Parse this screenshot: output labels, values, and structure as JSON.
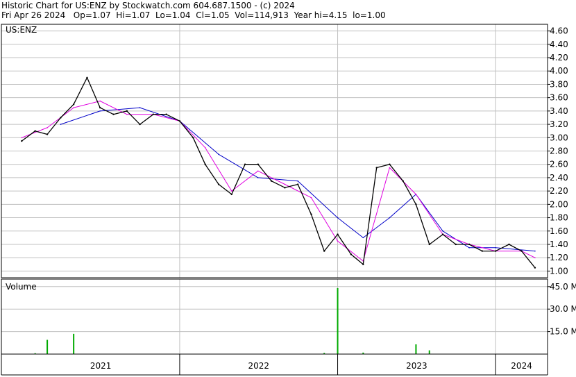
{
  "header": {
    "line1": "Historic Chart for US:ENZ by Stockwatch.com 604.687.1500 - (c) 2024",
    "line2": "Fri Apr 26 2024   Op=1.07  Hi=1.07  Lo=1.04  Cl=1.05  Vol=114,913  Year hi=4.15  lo=1.00"
  },
  "price_panel": {
    "label": "US:ENZ"
  },
  "volume_panel": {
    "label": "Volume"
  },
  "colors": {
    "price": "#000000",
    "ma_short": "#e000e0",
    "ma_long": "#0000c8",
    "grid": "#c0c0c0",
    "volume_up": "#00aa00",
    "volume_down": "#cc0000",
    "frame": "#000000"
  },
  "chart_data": [
    {
      "type": "line",
      "title": "US:ENZ",
      "ylim": [
        0.9,
        4.7
      ],
      "y_ticks": [
        "4.60",
        "4.40",
        "4.20",
        "4.00",
        "3.80",
        "3.60",
        "3.40",
        "3.20",
        "3.00",
        "2.80",
        "2.60",
        "2.40",
        "2.20",
        "2.00",
        "1.80",
        "1.60",
        "1.40",
        "1.20",
        "1.00"
      ],
      "x_labels": [
        "2021",
        "2022",
        "2023",
        "2024"
      ],
      "grid": true,
      "series": [
        {
          "role": "price",
          "x": [
            "2021-01",
            "2021-02",
            "2021-03",
            "2021-04",
            "2021-05",
            "2021-06",
            "2021-07",
            "2021-08",
            "2021-09",
            "2021-10",
            "2021-11",
            "2021-12",
            "2022-01",
            "2022-02",
            "2022-03",
            "2022-04",
            "2022-05",
            "2022-06",
            "2022-07",
            "2022-08",
            "2022-09",
            "2022-10",
            "2022-11",
            "2022-12",
            "2023-01",
            "2023-02",
            "2023-03",
            "2023-04",
            "2023-05",
            "2023-06",
            "2023-07",
            "2023-08",
            "2023-09",
            "2023-10",
            "2023-11",
            "2023-12",
            "2024-01",
            "2024-02",
            "2024-03",
            "2024-04"
          ],
          "values": [
            2.95,
            3.1,
            3.05,
            3.3,
            3.5,
            3.9,
            3.45,
            3.35,
            3.4,
            3.2,
            3.35,
            3.35,
            3.25,
            3.0,
            2.6,
            2.3,
            2.15,
            2.6,
            2.6,
            2.35,
            2.25,
            2.3,
            1.85,
            1.3,
            1.55,
            1.25,
            1.1,
            2.55,
            2.6,
            2.35,
            2.0,
            1.4,
            1.55,
            1.4,
            1.4,
            1.3,
            1.3,
            1.4,
            1.3,
            1.05
          ]
        },
        {
          "role": "ma_short",
          "x": [
            "2021-01",
            "2021-03",
            "2021-05",
            "2021-07",
            "2021-09",
            "2021-11",
            "2022-01",
            "2022-03",
            "2022-05",
            "2022-07",
            "2022-09",
            "2022-11",
            "2023-01",
            "2023-03",
            "2023-05",
            "2023-07",
            "2023-09",
            "2023-11",
            "2024-01",
            "2024-03",
            "2024-04"
          ],
          "values": [
            3.0,
            3.15,
            3.45,
            3.55,
            3.35,
            3.35,
            3.25,
            2.85,
            2.2,
            2.5,
            2.3,
            2.1,
            1.45,
            1.15,
            2.55,
            2.15,
            1.55,
            1.4,
            1.3,
            1.3,
            1.2
          ]
        },
        {
          "role": "ma_long",
          "x": [
            "2021-04",
            "2021-07",
            "2021-10",
            "2022-01",
            "2022-04",
            "2022-07",
            "2022-10",
            "2023-01",
            "2023-03",
            "2023-05",
            "2023-07",
            "2023-09",
            "2023-11",
            "2024-01",
            "2024-04"
          ],
          "values": [
            3.2,
            3.4,
            3.45,
            3.25,
            2.75,
            2.4,
            2.35,
            1.8,
            1.5,
            1.8,
            2.15,
            1.6,
            1.35,
            1.35,
            1.3
          ]
        }
      ]
    },
    {
      "type": "bar",
      "title": "Volume",
      "ylim": [
        0,
        50
      ],
      "y_ticks": [
        "45.0 M",
        "30.0 M",
        "15.0 M"
      ],
      "x": [
        "2021-02",
        "2021-03",
        "2021-05",
        "2022-12",
        "2023-01",
        "2023-03",
        "2023-07",
        "2023-08"
      ],
      "values": [
        0.6,
        9.5,
        13.5,
        0.8,
        44.0,
        1.0,
        6.5,
        2.5
      ]
    }
  ]
}
